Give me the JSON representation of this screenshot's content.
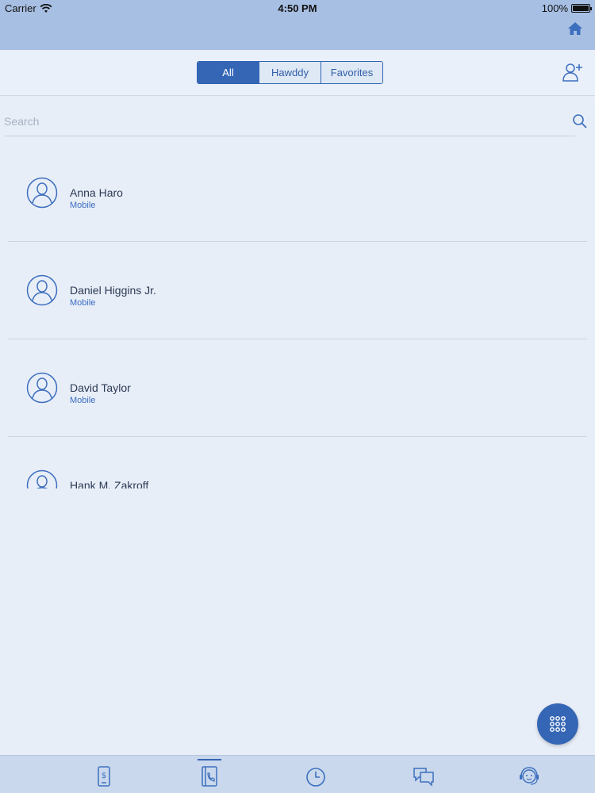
{
  "status_bar": {
    "carrier": "Carrier",
    "time": "4:50 PM",
    "battery": "100%"
  },
  "filter_tabs": [
    {
      "label": "All",
      "active": true
    },
    {
      "label": "Hawddy",
      "active": false
    },
    {
      "label": "Favorites",
      "active": false
    }
  ],
  "search": {
    "placeholder": "Search",
    "value": ""
  },
  "contacts": [
    {
      "name": "Anna Haro",
      "type": "Mobile"
    },
    {
      "name": "Daniel Higgins Jr.",
      "type": "Mobile"
    },
    {
      "name": "David Taylor",
      "type": "Mobile"
    },
    {
      "name": "Hank M. Zakroff",
      "type": ""
    }
  ],
  "bottom_tabs": [
    {
      "icon": "mobile-billing-icon",
      "active": false
    },
    {
      "icon": "contacts-book-icon",
      "active": true
    },
    {
      "icon": "recents-clock-icon",
      "active": false
    },
    {
      "icon": "messages-icon",
      "active": false
    },
    {
      "icon": "support-agent-icon",
      "active": false
    }
  ],
  "icons": {
    "nav": "home-icon",
    "toolbar": "add-contact-icon",
    "search": "search-icon",
    "fab": "dialpad-icon",
    "contact": "contact-avatar-icon"
  },
  "colors": {
    "header": "#a7bfe2",
    "background": "#e8eef8",
    "accent": "#3566b5",
    "tab_bar": "#c9d8ec"
  }
}
